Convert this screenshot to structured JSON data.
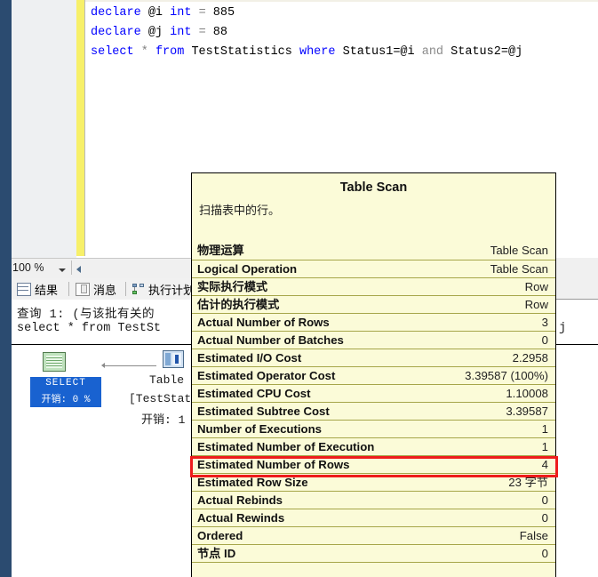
{
  "editor": {
    "lines": [
      {
        "id": "line1",
        "tokens": [
          {
            "t": "declare",
            "c": "kw"
          },
          {
            "t": " ",
            "c": "plain"
          },
          {
            "t": "@i",
            "c": "id"
          },
          {
            "t": " ",
            "c": "plain"
          },
          {
            "t": "int",
            "c": "kw"
          },
          {
            "t": " ",
            "c": "plain"
          },
          {
            "t": "=",
            "c": "op"
          },
          {
            "t": " ",
            "c": "plain"
          },
          {
            "t": "885",
            "c": "num"
          }
        ],
        "text": "declare @i int = 885"
      },
      {
        "id": "line2",
        "tokens": [
          {
            "t": "declare",
            "c": "kw"
          },
          {
            "t": " ",
            "c": "plain"
          },
          {
            "t": "@j",
            "c": "id"
          },
          {
            "t": " ",
            "c": "plain"
          },
          {
            "t": "int",
            "c": "kw"
          },
          {
            "t": " ",
            "c": "plain"
          },
          {
            "t": "=",
            "c": "op"
          },
          {
            "t": " ",
            "c": "plain"
          },
          {
            "t": "88",
            "c": "num"
          }
        ],
        "text": "declare @j int = 88"
      },
      {
        "id": "line3",
        "tokens": [
          {
            "t": "select",
            "c": "kw"
          },
          {
            "t": " ",
            "c": "plain"
          },
          {
            "t": "*",
            "c": "op"
          },
          {
            "t": " ",
            "c": "plain"
          },
          {
            "t": "from",
            "c": "kw"
          },
          {
            "t": " ",
            "c": "plain"
          },
          {
            "t": "TestStatistics",
            "c": "id"
          },
          {
            "t": " ",
            "c": "plain"
          },
          {
            "t": "where",
            "c": "kw"
          },
          {
            "t": " ",
            "c": "plain"
          },
          {
            "t": "Status1=@i",
            "c": "id"
          },
          {
            "t": " ",
            "c": "plain"
          },
          {
            "t": "and",
            "c": "kw-gray"
          },
          {
            "t": " ",
            "c": "plain"
          },
          {
            "t": "Status2=@j",
            "c": "id"
          }
        ],
        "text": "select * from TestStatistics where Status1=@i and Status2=@j"
      }
    ]
  },
  "zoom_bar": {
    "zoom_level": "100 %",
    "dropdown_icon": "chevron-down-icon",
    "scroll_left_icon": "scroll-left-arrow-icon"
  },
  "result_tabs": [
    {
      "id": "results",
      "label": "结果",
      "icon": "results-grid-icon",
      "active": false
    },
    {
      "id": "messages",
      "label": "消息",
      "icon": "messages-paper-icon",
      "active": false
    },
    {
      "id": "execution_plan",
      "label": "执行计划",
      "icon": "execution-plan-icon",
      "active": true
    }
  ],
  "plan": {
    "query_header": "查询 1: (与该批有关的",
    "query_text": "select * from TestSt",
    "select_node": {
      "icon": "select-result-icon",
      "label": "SELECT",
      "cost": "开销: 0 %"
    },
    "table_scan_node": {
      "icon": "table-scan-icon",
      "line1": "Table",
      "line2": "[TestStat",
      "line3": "开销: 1"
    },
    "arrow_icon": "data-flow-arrow-icon"
  },
  "tooltip": {
    "title": "Table Scan",
    "description": "扫描表中的行。",
    "rows": [
      {
        "key": "物理运算",
        "value": "Table Scan",
        "highlighted": false
      },
      {
        "key": "Logical Operation",
        "value": "Table Scan",
        "highlighted": false
      },
      {
        "key": "实际执行模式",
        "value": "Row",
        "highlighted": false
      },
      {
        "key": "估计的执行模式",
        "value": "Row",
        "highlighted": false
      },
      {
        "key": "Actual Number of Rows",
        "value": "3",
        "highlighted": false
      },
      {
        "key": "Actual Number of Batches",
        "value": "0",
        "highlighted": false
      },
      {
        "key": "Estimated I/O Cost",
        "value": "2.2958",
        "highlighted": false
      },
      {
        "key": "Estimated Operator Cost",
        "value": "3.39587 (100%)",
        "highlighted": false
      },
      {
        "key": "Estimated CPU Cost",
        "value": "1.10008",
        "highlighted": false
      },
      {
        "key": "Estimated Subtree Cost",
        "value": "3.39587",
        "highlighted": false
      },
      {
        "key": "Number of Executions",
        "value": "1",
        "highlighted": false
      },
      {
        "key": "Estimated Number of Executions",
        "value": "1",
        "highlighted": false
      },
      {
        "key": "Estimated Number of Rows",
        "value": "4",
        "highlighted": true
      },
      {
        "key": "Estimated Row Size",
        "value": "23 字节",
        "highlighted": false
      },
      {
        "key": "Actual Rebinds",
        "value": "0",
        "highlighted": false
      },
      {
        "key": "Actual Rewinds",
        "value": "0",
        "highlighted": false
      },
      {
        "key": "Ordered",
        "value": "False",
        "highlighted": false
      },
      {
        "key": "节点 ID",
        "value": "0",
        "highlighted": false
      }
    ],
    "highlight_color": "#ee1c1c",
    "background_color": "#fbfbd8"
  },
  "misc": {
    "residual_char": "j"
  }
}
